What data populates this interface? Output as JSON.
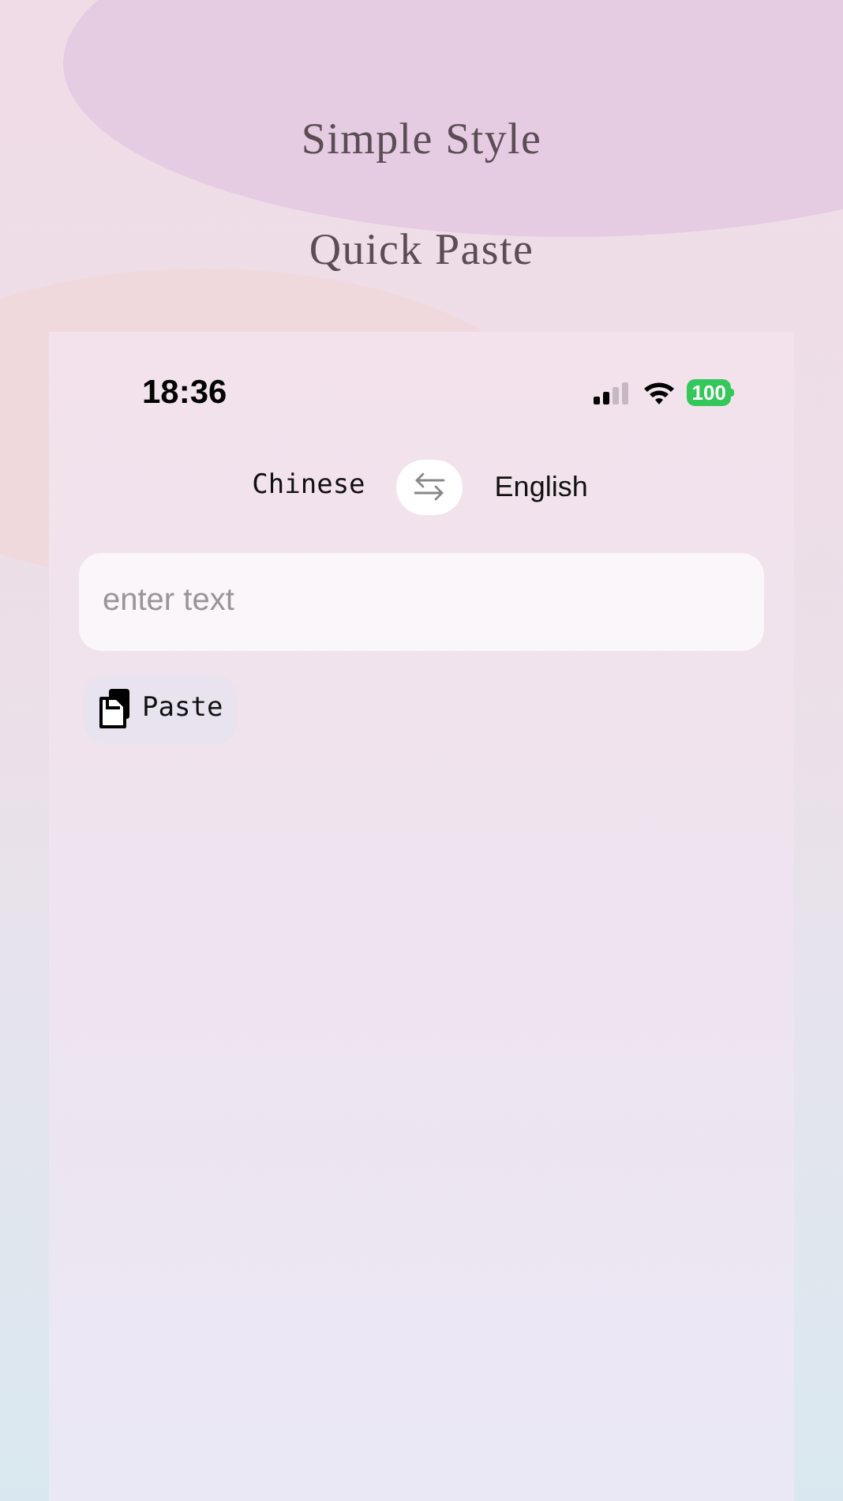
{
  "headline": [
    "Simple Style",
    "Quick Paste"
  ],
  "status_bar": {
    "time": "18:36",
    "battery": "100"
  },
  "languages": {
    "source": "Chinese",
    "target": "English"
  },
  "input": {
    "placeholder": "enter text"
  },
  "paste_button": {
    "label": "Paste"
  }
}
